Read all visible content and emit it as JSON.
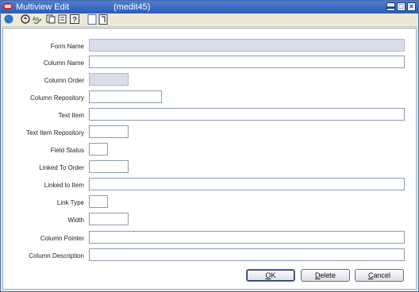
{
  "window": {
    "title": "Multiview Edit",
    "subtitle": "(medit45)",
    "controls": {
      "minimize": "▬",
      "maximize": "□",
      "close": "×"
    }
  },
  "toolbar": {
    "icons": [
      "globe-icon",
      "navigate-icon",
      "spellcheck-icon",
      "documents-icon",
      "help-icon",
      "blank-doc-icon",
      "open-doc-icon"
    ],
    "help_glyph": "?"
  },
  "form": {
    "fields": [
      {
        "label": "Form Name",
        "value": "",
        "disabled": true
      },
      {
        "label": "Column Name",
        "value": ""
      },
      {
        "label": "Column Order",
        "value": "",
        "disabled": true
      },
      {
        "label": "Column Repository",
        "value": ""
      },
      {
        "label": "Text Item",
        "value": ""
      },
      {
        "label": "Text Item Repository",
        "value": ""
      },
      {
        "label": "Field Status",
        "value": ""
      },
      {
        "label": "Linked To Order",
        "value": ""
      },
      {
        "label": "Linked to Item",
        "value": ""
      },
      {
        "label": "Link Type",
        "value": ""
      },
      {
        "label": "Width",
        "value": ""
      },
      {
        "label": "Column Pointer",
        "value": ""
      },
      {
        "label": "Column Description",
        "value": ""
      }
    ]
  },
  "buttons": {
    "ok": {
      "mnemonic": "O",
      "rest": "K"
    },
    "delete": {
      "mnemonic": "D",
      "rest": "elete"
    },
    "cancel": {
      "mnemonic": "C",
      "rest": "ancel"
    }
  }
}
